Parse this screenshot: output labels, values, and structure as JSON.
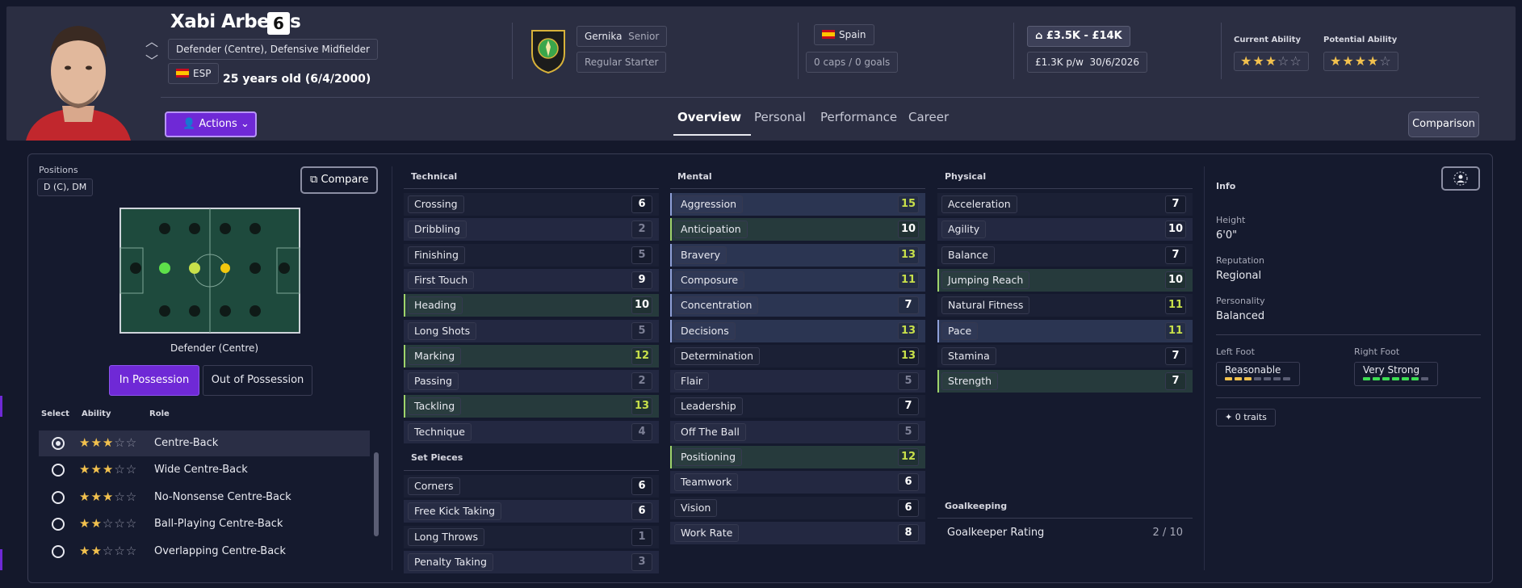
{
  "player": {
    "name": "Xabi Arberas",
    "number": "6",
    "positions_text": "Defender (Centre), Defensive Midfielder",
    "nationality_code": "ESP",
    "age_text": "25 years old (6/4/2000)"
  },
  "club": {
    "name": "Gernika",
    "level": "Senior",
    "status": "Regular Starter"
  },
  "nation": {
    "name": "Spain",
    "caps": "0 caps / 0 goals"
  },
  "contract": {
    "value_range": "£3.5K - £14K",
    "wage": "£1.3K p/w",
    "expiry": "30/6/2026"
  },
  "ability": {
    "current_label": "Current Ability",
    "current_stars": 3,
    "potential_label": "Potential Ability",
    "potential_stars": 4,
    "max_stars": 5
  },
  "actions_label": "Actions",
  "tabs": [
    "Overview",
    "Personal",
    "Performance",
    "Career"
  ],
  "comparison_label": "Comparison",
  "positions_panel": {
    "label": "Positions",
    "value": "D (C), DM",
    "compare_label": "Compare",
    "pitch_caption": "Defender (Centre)",
    "in_possession": "In Possession",
    "out_of_possession": "Out of Possession",
    "headers": [
      "Select",
      "Ability",
      "Role"
    ],
    "roles": [
      {
        "name": "Centre-Back",
        "stars": 3,
        "selected": true
      },
      {
        "name": "Wide Centre-Back",
        "stars": 3,
        "selected": false
      },
      {
        "name": "No-Nonsense Centre-Back",
        "stars": 3,
        "selected": false
      },
      {
        "name": "Ball-Playing Centre-Back",
        "stars": 2,
        "selected": false
      },
      {
        "name": "Overlapping Centre-Back",
        "stars": 2,
        "selected": false
      }
    ]
  },
  "technical": {
    "title": "Technical",
    "items": [
      {
        "name": "Crossing",
        "value": 6,
        "hl": ""
      },
      {
        "name": "Dribbling",
        "value": 2,
        "hl": ""
      },
      {
        "name": "Finishing",
        "value": 5,
        "hl": ""
      },
      {
        "name": "First Touch",
        "value": 9,
        "hl": ""
      },
      {
        "name": "Heading",
        "value": 10,
        "hl": "green"
      },
      {
        "name": "Long Shots",
        "value": 5,
        "hl": ""
      },
      {
        "name": "Marking",
        "value": 12,
        "hl": "green"
      },
      {
        "name": "Passing",
        "value": 2,
        "hl": ""
      },
      {
        "name": "Tackling",
        "value": 13,
        "hl": "green"
      },
      {
        "name": "Technique",
        "value": 4,
        "hl": ""
      }
    ]
  },
  "set_pieces": {
    "title": "Set Pieces",
    "items": [
      {
        "name": "Corners",
        "value": 6,
        "hl": ""
      },
      {
        "name": "Free Kick Taking",
        "value": 6,
        "hl": ""
      },
      {
        "name": "Long Throws",
        "value": 1,
        "hl": ""
      },
      {
        "name": "Penalty Taking",
        "value": 3,
        "hl": ""
      }
    ]
  },
  "mental": {
    "title": "Mental",
    "items": [
      {
        "name": "Aggression",
        "value": 15,
        "hl": "blue"
      },
      {
        "name": "Anticipation",
        "value": 10,
        "hl": "green"
      },
      {
        "name": "Bravery",
        "value": 13,
        "hl": "blue"
      },
      {
        "name": "Composure",
        "value": 11,
        "hl": "blue"
      },
      {
        "name": "Concentration",
        "value": 7,
        "hl": "blue"
      },
      {
        "name": "Decisions",
        "value": 13,
        "hl": "blue"
      },
      {
        "name": "Determination",
        "value": 13,
        "hl": ""
      },
      {
        "name": "Flair",
        "value": 5,
        "hl": ""
      },
      {
        "name": "Leadership",
        "value": 7,
        "hl": ""
      },
      {
        "name": "Off The Ball",
        "value": 5,
        "hl": ""
      },
      {
        "name": "Positioning",
        "value": 12,
        "hl": "green"
      },
      {
        "name": "Teamwork",
        "value": 6,
        "hl": ""
      },
      {
        "name": "Vision",
        "value": 6,
        "hl": ""
      },
      {
        "name": "Work Rate",
        "value": 8,
        "hl": ""
      }
    ]
  },
  "physical": {
    "title": "Physical",
    "items": [
      {
        "name": "Acceleration",
        "value": 7,
        "hl": ""
      },
      {
        "name": "Agility",
        "value": 10,
        "hl": ""
      },
      {
        "name": "Balance",
        "value": 7,
        "hl": ""
      },
      {
        "name": "Jumping Reach",
        "value": 10,
        "hl": "green"
      },
      {
        "name": "Natural Fitness",
        "value": 11,
        "hl": ""
      },
      {
        "name": "Pace",
        "value": 11,
        "hl": "blue"
      },
      {
        "name": "Stamina",
        "value": 7,
        "hl": ""
      },
      {
        "name": "Strength",
        "value": 7,
        "hl": "green"
      }
    ]
  },
  "goalkeeping": {
    "title": "Goalkeeping",
    "label": "Goalkeeper Rating",
    "value": "2 / 10"
  },
  "info": {
    "title": "Info",
    "height_label": "Height",
    "height": "6'0\"",
    "reputation_label": "Reputation",
    "reputation": "Regional",
    "personality_label": "Personality",
    "personality": "Balanced",
    "left_foot_label": "Left Foot",
    "left_foot": "Reasonable",
    "left_foot_level": 3,
    "right_foot_label": "Right Foot",
    "right_foot": "Very Strong",
    "right_foot_level": 6,
    "traits": "0 traits"
  },
  "colors": {
    "accent": "#6f29d6",
    "star": "#f2c14e",
    "high": "#c8e04a",
    "normal": "#ffffff",
    "low": "#7d8096",
    "foot_on_yellow": "#f2c14e",
    "foot_on_green": "#3ddc54",
    "foot_off": "#5a5d74"
  }
}
